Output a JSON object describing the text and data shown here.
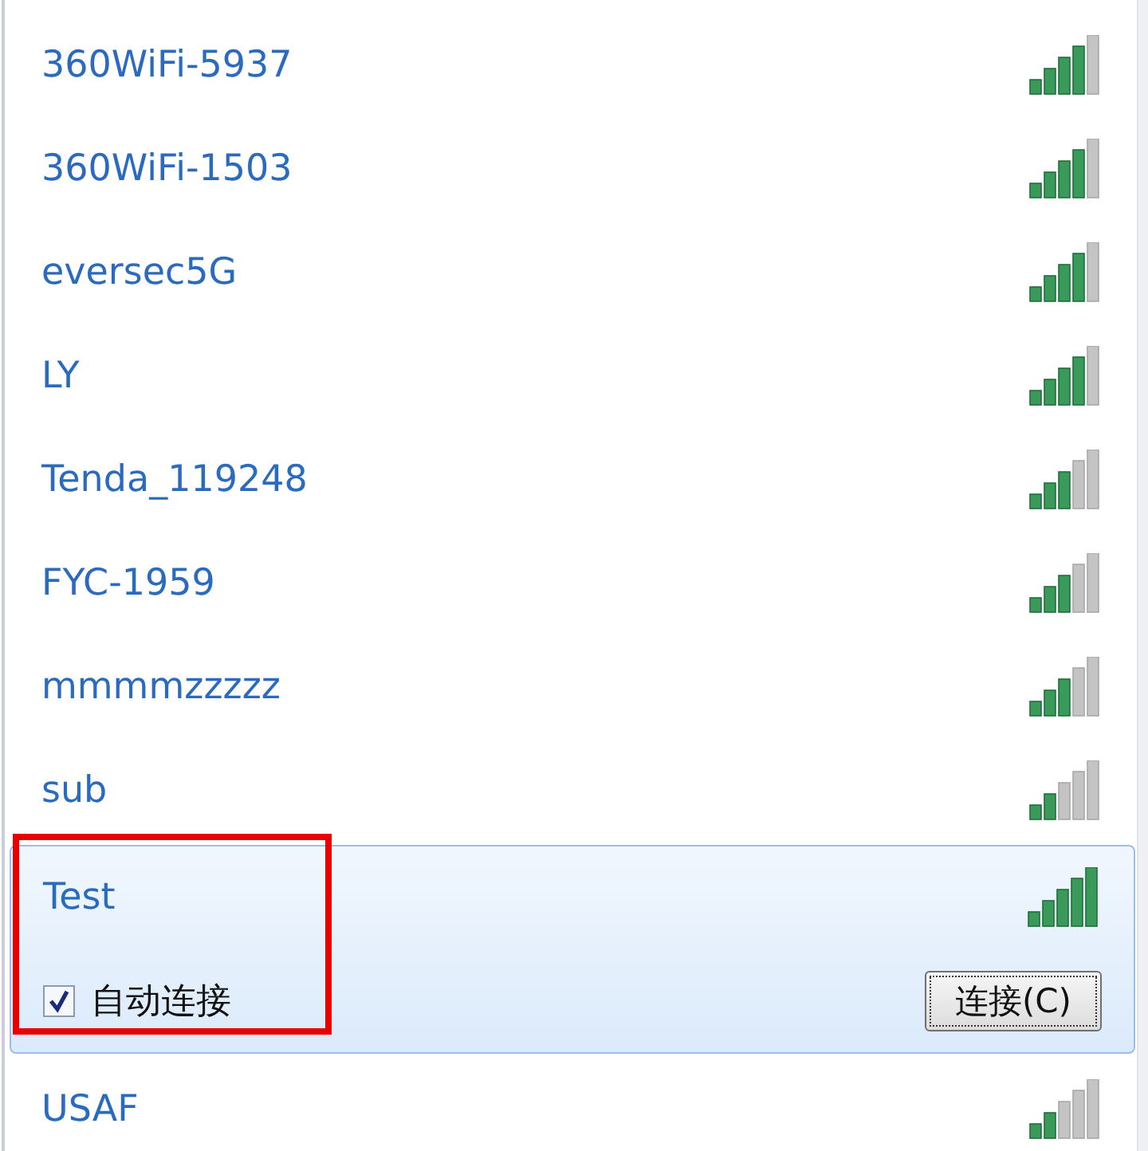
{
  "networks": [
    {
      "name": "360WiFi-5937",
      "kind": "good",
      "selected": false,
      "highlighted": false
    },
    {
      "name": "360WiFi-1503",
      "kind": "good",
      "selected": false,
      "highlighted": false
    },
    {
      "name": "eversec5G",
      "kind": "good",
      "selected": false,
      "highlighted": false
    },
    {
      "name": "LY",
      "kind": "good",
      "selected": false,
      "highlighted": false
    },
    {
      "name": "Tenda_119248",
      "kind": "fair",
      "selected": false,
      "highlighted": false
    },
    {
      "name": "FYC-1959",
      "kind": "fair",
      "selected": false,
      "highlighted": false
    },
    {
      "name": "mmmmzzzzz",
      "kind": "fair",
      "selected": false,
      "highlighted": false
    },
    {
      "name": "sub",
      "kind": "weak",
      "selected": false,
      "highlighted": false
    },
    {
      "name": "Test",
      "kind": "excellent",
      "selected": true,
      "highlighted": true,
      "auto_connect": {
        "label": "自动连接",
        "checked": true
      },
      "connect_button": "连接(C)"
    },
    {
      "name": "USAF",
      "kind": "weak",
      "selected": false,
      "highlighted": false
    }
  ]
}
